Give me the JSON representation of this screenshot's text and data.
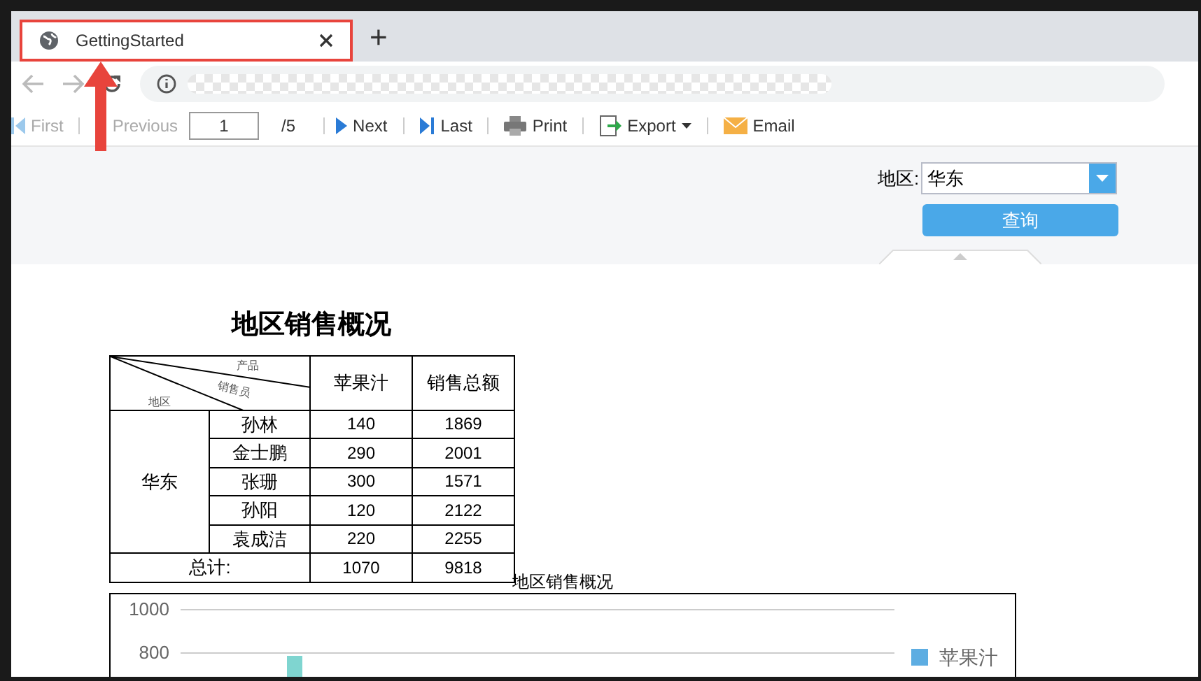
{
  "browser": {
    "tab": {
      "title": "GettingStarted",
      "selected": true
    },
    "new_tab": "+"
  },
  "toolbar": {
    "items": [
      {
        "kind": "first",
        "label": "First",
        "disabled": true
      },
      {
        "kind": "previous",
        "label": "Previous",
        "disabled": true
      },
      {
        "kind": "page",
        "value": "1",
        "total": "/5"
      },
      {
        "kind": "next",
        "label": "Next",
        "disabled": false
      },
      {
        "kind": "last",
        "label": "Last",
        "disabled": false
      },
      {
        "kind": "print",
        "label": "Print",
        "disabled": false
      },
      {
        "kind": "export",
        "label": "Export",
        "disabled": false
      },
      {
        "kind": "email",
        "label": "Email",
        "disabled": false
      }
    ]
  },
  "parameters": {
    "region_label": "地区:",
    "region_value": "华东",
    "query_button": "查询"
  },
  "report": {
    "title": "地区销售概况",
    "corner": {
      "top": "产品",
      "middle": "销售员",
      "bottom": "地区"
    },
    "columns": [
      "苹果汁",
      "销售总额"
    ],
    "region": "华东",
    "rows": [
      {
        "name": "孙林",
        "juice": "140",
        "total": "1869"
      },
      {
        "name": "金士鹏",
        "juice": "290",
        "total": "2001"
      },
      {
        "name": "张珊",
        "juice": "300",
        "total": "1571"
      },
      {
        "name": "孙阳",
        "juice": "120",
        "total": "2122"
      },
      {
        "name": "袁成洁",
        "juice": "220",
        "total": "2255"
      }
    ],
    "sum": {
      "label": "总计:",
      "juice": "1070",
      "total": "9818"
    }
  },
  "chart": {
    "title": "地区销售概况",
    "axis_labels": [
      "1000",
      "800"
    ],
    "legend": [
      {
        "label": "苹果汁",
        "color": "#5dade2"
      }
    ]
  }
}
